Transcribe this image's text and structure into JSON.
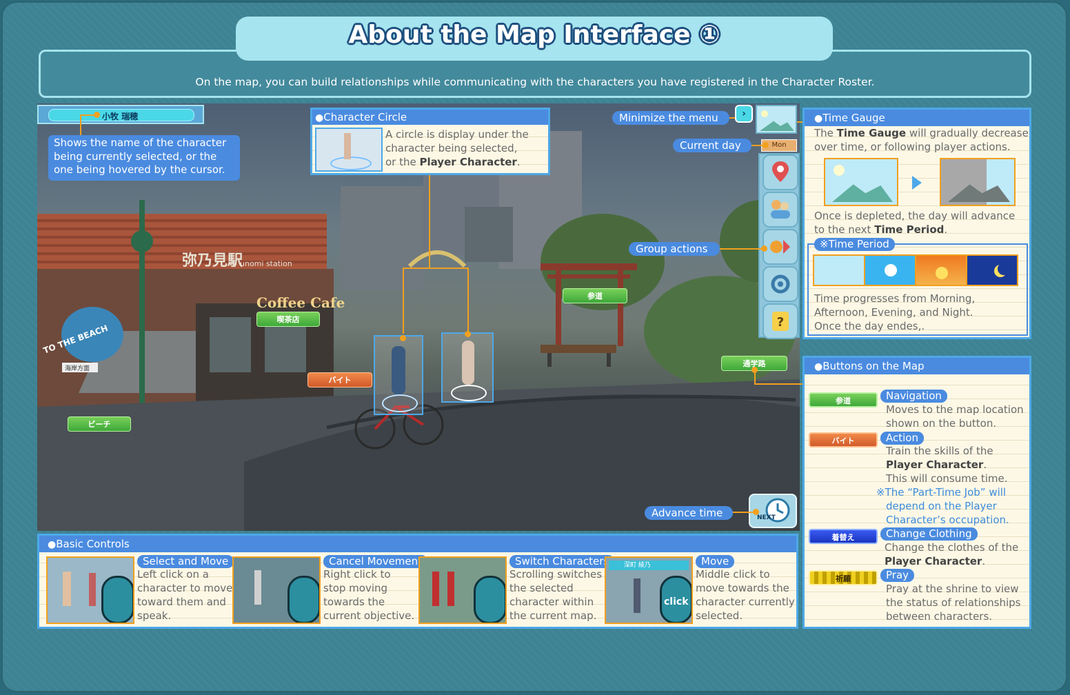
{
  "header": {
    "title": "About the Map Interface ①",
    "intro": "On the map, you can build relationships while communicating with the characters you have registered in the Character Roster."
  },
  "scene": {
    "name_plate": "小牧 瑞穂",
    "station_sign": "弥乃見駅",
    "station_sign_roman": "unomi station",
    "cafe_sign": "Coffee Cafe",
    "beach_sign": "TO THE BEACH",
    "sign_direction": "海岸方面",
    "nav_buttons": {
      "kissaten": "喫茶店",
      "sando": "参道",
      "beach": "ビーチ",
      "baito": "バイト",
      "tsugakuro": "通学路"
    },
    "current_day_badge": "Mon",
    "next_label": "NEXT"
  },
  "callouts": {
    "name_desc": "Shows the name of the character being currently selected, or the one being hovered by the cursor.",
    "minimize": "Minimize the menu",
    "current_day": "Current day",
    "group_actions": "Group actions",
    "advance_time": "Advance time"
  },
  "character_circle": {
    "heading": "Character Circle",
    "line1": "A circle is display under the",
    "line2": "character being selected,",
    "line3_pre": "or the ",
    "line3_bold": "Player Character",
    "line3_post": "."
  },
  "time_gauge": {
    "heading": "Time Gauge",
    "l1_pre": "The ",
    "l1_bold": "Time Gauge",
    "l1_post": " will gradually decrease",
    "l2": "over time, or following player actions.",
    "l3": "Once is depleted, the day will advance",
    "l4_pre": "to the next ",
    "l4_bold": "Time Period",
    "l4_post": ".",
    "period_label": "※Time Period",
    "p1": "Time progresses from Morning,",
    "p2": "Afternoon, Evening, and Night.",
    "p3": "Once the day endes,."
  },
  "buttons_map": {
    "heading": "Buttons on the Map",
    "navigation_title": "Navigation",
    "navigation_l1": "Moves to the map location",
    "navigation_l2": "shown on the button.",
    "action_title": "Action",
    "action_l1": "Train the skills of the",
    "action_l2": "Player Character",
    "action_l2_post": ".",
    "action_l3": "This will consume time.",
    "action_note1": "※The “Part-Time Job” will",
    "action_note2": "depend on the Player",
    "action_note3": "Character’s occupation.",
    "clothing_title": "Change Clothing",
    "clothing_l1": "Change the clothes of the",
    "clothing_l2": "Player Character",
    "clothing_l2_post": ".",
    "pray_title": "Pray",
    "pray_l1": "Pray at the shrine to view",
    "pray_l2": "the status of relationships",
    "pray_l3": "between characters.",
    "btn_nav": "参道",
    "btn_action": "バイト",
    "btn_clothing": "着替え",
    "btn_pray": "祈願"
  },
  "basic_controls": {
    "heading": "Basic Controls",
    "items": [
      {
        "title": "Select and Move",
        "l1": "Left click on a",
        "l2": "character to move",
        "l3": "toward them and",
        "l4": "speak."
      },
      {
        "title": "Cancel Movement",
        "l1": "Right click to",
        "l2": "stop moving",
        "l3": "towards the",
        "l4": "current objective."
      },
      {
        "title": "Switch Characters",
        "l1": "Scrolling switches",
        "l2": "the selected",
        "l3": "character within",
        "l4": "the current map."
      },
      {
        "title": "Move",
        "l1": "Middle click to",
        "l2": "move towards the",
        "l3": "character currently",
        "l4": "selected."
      }
    ],
    "thumb4_label": "深町 綾乃",
    "click_label": "click"
  },
  "colors": {
    "accent_blue": "#4a8be0",
    "connector_orange": "#f2a01e",
    "panel_bg": "#fdf8e6",
    "frame_teal": "#3d8394"
  }
}
